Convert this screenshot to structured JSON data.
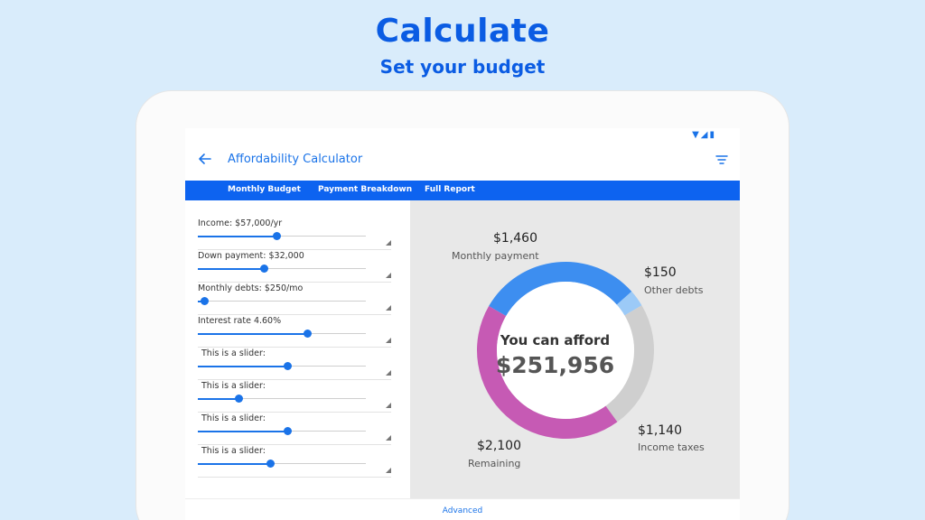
{
  "hero": {
    "title": "Calculate",
    "subtitle": "Set your budget"
  },
  "status_bar": {
    "icons": [
      "wifi-icon",
      "signal-icon",
      "battery-icon"
    ]
  },
  "app_bar": {
    "title": "Affordability Calculator",
    "back_icon": "arrow-left-icon",
    "menu_icon": "filter-list-icon"
  },
  "tabs": [
    {
      "label": "Monthly Budget"
    },
    {
      "label": "Payment Breakdown"
    },
    {
      "label": "Full Report"
    }
  ],
  "sliders": [
    {
      "label": "Income:  $57,000/yr",
      "value": 0.47
    },
    {
      "label": "Down payment:  $32,000",
      "value": 0.39
    },
    {
      "label": "Monthly debts:  $250/mo",
      "value": 0.04
    },
    {
      "label": "Interest rate   4.60%",
      "value": 0.65
    },
    {
      "label": "This is a slider:",
      "value": 0.53
    },
    {
      "label": "This is a slider:",
      "value": 0.24
    },
    {
      "label": "This is a slider:",
      "value": 0.53
    },
    {
      "label": "This is a slider:",
      "value": 0.43
    }
  ],
  "summary": {
    "title": "You can afford",
    "amount": "$251,956"
  },
  "segments": [
    {
      "value": "$1,460",
      "label": "Monthly payment",
      "amount": 1460,
      "color": "#3d8ef0"
    },
    {
      "value": "$150",
      "label": "Other debts",
      "amount": 150,
      "color": "#9ccaf7"
    },
    {
      "value": "$1,140",
      "label": "Income taxes",
      "amount": 1140,
      "color": "#cfcfcf"
    },
    {
      "value": "$2,100",
      "label": "Remaining",
      "amount": 2100,
      "color": "#c65ab4"
    }
  ],
  "footer": {
    "advanced_label": "Advanced"
  },
  "colors": {
    "brand": "#0b5ce3",
    "tab_bar": "#0d63f0",
    "accent": "#1a73e8",
    "background": "#d9ecfb"
  }
}
